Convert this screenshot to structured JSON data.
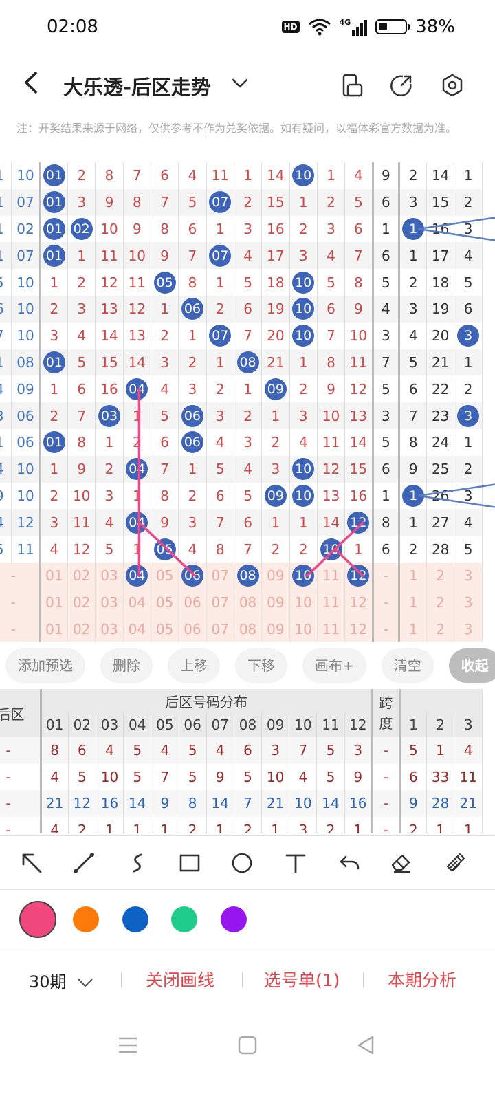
{
  "status_bar": {
    "time": "02:08",
    "hd": "HD",
    "network": "4G",
    "battery": "38%"
  },
  "header": {
    "title": "大乐透-后区走势"
  },
  "note": "注：开奖结果来源于网络，仅供参考不作为兑奖依据。如有疑问，以福体彩官方数据为准。",
  "trend_rows": [
    {
      "lead": [
        "1",
        "10"
      ],
      "cells": [
        "01",
        "2",
        "8",
        "7",
        "6",
        "4",
        "11",
        "1",
        "14",
        "10",
        "1",
        "4"
      ],
      "balls": [
        0,
        9
      ],
      "span": "9",
      "tail": [
        "2",
        "14",
        "1"
      ],
      "tail_ball": -1
    },
    {
      "lead": [
        "1",
        "07"
      ],
      "cells": [
        "01",
        "3",
        "9",
        "8",
        "7",
        "5",
        "07",
        "2",
        "15",
        "1",
        "2",
        "5"
      ],
      "balls": [
        0,
        6
      ],
      "span": "6",
      "tail": [
        "3",
        "15",
        "2"
      ],
      "tail_ball": -1
    },
    {
      "lead": [
        "1",
        "02"
      ],
      "cells": [
        "01",
        "02",
        "10",
        "9",
        "8",
        "6",
        "1",
        "3",
        "16",
        "2",
        "3",
        "6"
      ],
      "balls": [
        0,
        1
      ],
      "span": "1",
      "tail": [
        "1",
        "16",
        "3"
      ],
      "tail_ball": 0
    },
    {
      "lead": [
        "1",
        "07"
      ],
      "cells": [
        "01",
        "1",
        "11",
        "10",
        "9",
        "7",
        "07",
        "4",
        "17",
        "3",
        "4",
        "7"
      ],
      "balls": [
        0,
        6
      ],
      "span": "6",
      "tail": [
        "1",
        "17",
        "4"
      ],
      "tail_ball": -1
    },
    {
      "lead": [
        "5",
        "10"
      ],
      "cells": [
        "1",
        "2",
        "12",
        "11",
        "05",
        "8",
        "1",
        "5",
        "18",
        "10",
        "5",
        "8"
      ],
      "balls": [
        4,
        9
      ],
      "span": "5",
      "tail": [
        "2",
        "18",
        "5"
      ],
      "tail_ball": -1
    },
    {
      "lead": [
        "6",
        "10"
      ],
      "cells": [
        "2",
        "3",
        "13",
        "12",
        "1",
        "06",
        "2",
        "6",
        "19",
        "10",
        "6",
        "9"
      ],
      "balls": [
        5,
        9
      ],
      "span": "4",
      "tail": [
        "3",
        "19",
        "6"
      ],
      "tail_ball": -1
    },
    {
      "lead": [
        "7",
        "10"
      ],
      "cells": [
        "3",
        "4",
        "14",
        "13",
        "2",
        "1",
        "07",
        "7",
        "20",
        "10",
        "7",
        "10"
      ],
      "balls": [
        6,
        9
      ],
      "span": "3",
      "tail": [
        "4",
        "20",
        "3"
      ],
      "tail_ball": 2
    },
    {
      "lead": [
        "1",
        "08"
      ],
      "cells": [
        "01",
        "5",
        "15",
        "14",
        "3",
        "2",
        "1",
        "08",
        "21",
        "1",
        "8",
        "11"
      ],
      "balls": [
        0,
        7
      ],
      "span": "7",
      "tail": [
        "5",
        "21",
        "1"
      ],
      "tail_ball": -1
    },
    {
      "lead": [
        "4",
        "09"
      ],
      "cells": [
        "1",
        "6",
        "16",
        "04",
        "4",
        "3",
        "2",
        "1",
        "09",
        "2",
        "9",
        "12"
      ],
      "balls": [
        3,
        8
      ],
      "span": "5",
      "tail": [
        "6",
        "22",
        "2"
      ],
      "tail_ball": -1
    },
    {
      "lead": [
        "3",
        "06"
      ],
      "cells": [
        "2",
        "7",
        "03",
        "1",
        "5",
        "06",
        "3",
        "2",
        "1",
        "3",
        "10",
        "13"
      ],
      "balls": [
        2,
        5
      ],
      "span": "3",
      "tail": [
        "7",
        "23",
        "3"
      ],
      "tail_ball": 2
    },
    {
      "lead": [
        "1",
        "06"
      ],
      "cells": [
        "01",
        "8",
        "1",
        "2",
        "6",
        "06",
        "4",
        "3",
        "2",
        "4",
        "11",
        "14"
      ],
      "balls": [
        0,
        5
      ],
      "span": "5",
      "tail": [
        "8",
        "24",
        "1"
      ],
      "tail_ball": -1
    },
    {
      "lead": [
        "4",
        "10"
      ],
      "cells": [
        "1",
        "9",
        "2",
        "04",
        "7",
        "1",
        "5",
        "4",
        "3",
        "10",
        "12",
        "15"
      ],
      "balls": [
        3,
        9
      ],
      "span": "6",
      "tail": [
        "9",
        "25",
        "2"
      ],
      "tail_ball": -1
    },
    {
      "lead": [
        "9",
        "10"
      ],
      "cells": [
        "2",
        "10",
        "3",
        "1",
        "8",
        "2",
        "6",
        "5",
        "09",
        "10",
        "13",
        "16"
      ],
      "balls": [
        8,
        9
      ],
      "span": "1",
      "tail": [
        "1",
        "26",
        "3"
      ],
      "tail_ball": 0
    },
    {
      "lead": [
        "4",
        "12"
      ],
      "cells": [
        "3",
        "11",
        "4",
        "04",
        "9",
        "3",
        "7",
        "6",
        "1",
        "1",
        "14",
        "12"
      ],
      "balls": [
        3,
        11
      ],
      "span": "8",
      "tail": [
        "1",
        "27",
        "4"
      ],
      "tail_ball": -1
    },
    {
      "lead": [
        "5",
        "11"
      ],
      "cells": [
        "4",
        "12",
        "5",
        "1",
        "05",
        "4",
        "8",
        "7",
        "2",
        "2",
        "10",
        "1"
      ],
      "balls": [
        4,
        10
      ],
      "span": "6",
      "tail": [
        "2",
        "28",
        "5"
      ],
      "tail_ball": -1
    }
  ],
  "preselect_rows": [
    {
      "lead": [
        "-"
      ],
      "cells": [
        "01",
        "02",
        "03",
        "04",
        "05",
        "06",
        "07",
        "08",
        "09",
        "10",
        "11",
        "12"
      ],
      "balls": [
        3,
        5,
        7,
        9,
        11
      ],
      "span": "-",
      "tail": [
        "1",
        "2",
        "3"
      ]
    },
    {
      "lead": [
        "-"
      ],
      "cells": [
        "01",
        "02",
        "03",
        "04",
        "05",
        "06",
        "07",
        "08",
        "09",
        "10",
        "11",
        "12"
      ],
      "balls": [],
      "span": "-",
      "tail": [
        "1",
        "2",
        "3"
      ]
    },
    {
      "lead": [
        "-"
      ],
      "cells": [
        "01",
        "02",
        "03",
        "04",
        "05",
        "06",
        "07",
        "08",
        "09",
        "10",
        "11",
        "12"
      ],
      "balls": [],
      "span": "-",
      "tail": [
        "1",
        "2",
        "3"
      ]
    }
  ],
  "action_buttons": [
    "添加预选",
    "删除",
    "上移",
    "下移",
    "画布+",
    "清空",
    "收起"
  ],
  "distribution": {
    "left_header": "后区",
    "group_header": "后区号码分布",
    "span_header": "跨度",
    "numbers": [
      "01",
      "02",
      "03",
      "04",
      "05",
      "06",
      "07",
      "08",
      "09",
      "10",
      "11",
      "12"
    ],
    "tail_numbers": [
      "1",
      "2",
      "3"
    ],
    "rows": [
      {
        "lead": "-",
        "values": [
          "8",
          "6",
          "4",
          "5",
          "4",
          "5",
          "4",
          "6",
          "3",
          "7",
          "5",
          "3"
        ],
        "span": "-",
        "tail": [
          "5",
          "1",
          "4"
        ],
        "color": "#9b2b2b"
      },
      {
        "lead": "-",
        "values": [
          "4",
          "5",
          "10",
          "5",
          "7",
          "5",
          "9",
          "5",
          "10",
          "4",
          "5",
          "9"
        ],
        "span": "-",
        "tail": [
          "6",
          "33",
          "11"
        ],
        "color": "#9b2b2b"
      },
      {
        "lead": "-",
        "values": [
          "21",
          "12",
          "16",
          "14",
          "9",
          "8",
          "14",
          "7",
          "21",
          "10",
          "14",
          "16"
        ],
        "span": "-",
        "tail": [
          "9",
          "28",
          "21"
        ],
        "color": "#2d63b5"
      },
      {
        "lead": "-",
        "values": [
          "4",
          "2",
          "1",
          "1",
          "1",
          "2",
          "1",
          "2",
          "1",
          "3",
          "2",
          "1"
        ],
        "span": "-",
        "tail": [
          "2",
          "1",
          "1"
        ],
        "color": "#9b2b2b"
      }
    ]
  },
  "draw_tools": [
    "arrow-tool",
    "line-tool",
    "curve-tool",
    "rectangle-tool",
    "circle-tool",
    "text-tool",
    "undo-tool",
    "eraser-tool",
    "brush-tool"
  ],
  "colors": [
    "#f0477e",
    "#fb7a0a",
    "#0d62c4",
    "#20cc8c",
    "#9716f0"
  ],
  "selected_color": "#f0477e",
  "bottom_bar": {
    "period": "30期",
    "close_lines": "关闭画线",
    "selection": "选号单(1)",
    "analysis": "本期分析"
  },
  "draw_line_color": "#e84a8a"
}
